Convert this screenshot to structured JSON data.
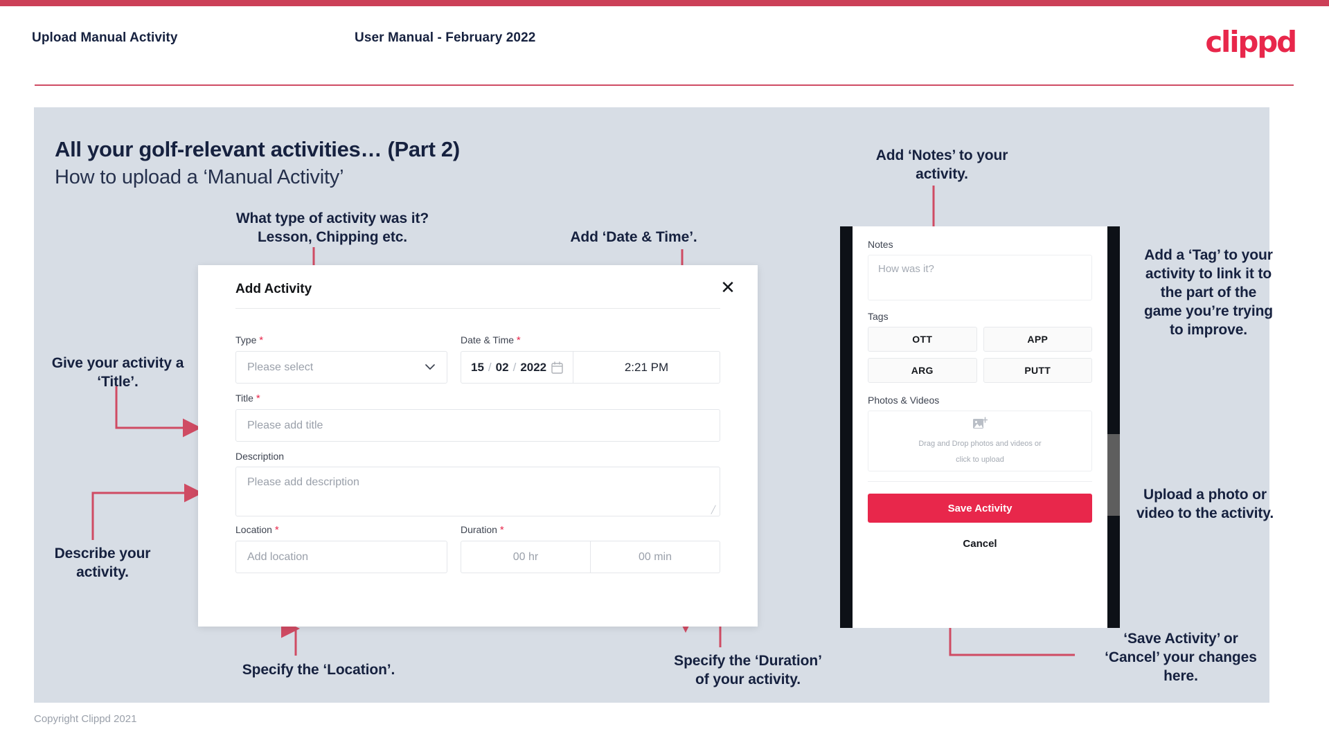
{
  "header": {
    "left_title": "Upload Manual Activity",
    "center_title": "User Manual - February 2022",
    "logo": "clippd"
  },
  "slide": {
    "title": "All your golf-relevant activities… (Part 2)",
    "subtitle": "How to upload a ‘Manual Activity’"
  },
  "annotations": {
    "type": "What type of activity was it?\nLesson, Chipping etc.",
    "datetime": "Add ‘Date & Time’.",
    "title_field": "Give your activity a\n‘Title’.",
    "description": "Describe your\nactivity.",
    "location": "Specify the ‘Location’.",
    "duration": "Specify the ‘Duration’\nof your activity.",
    "notes": "Add ‘Notes’ to your\nactivity.",
    "tags": "Add a ‘Tag’ to your\nactivity to link it to\nthe part of the\ngame you’re trying\nto improve.",
    "photos": "Upload a photo or\nvideo to the activity.",
    "save_cancel": "‘Save Activity’ or\n‘Cancel’ your changes\nhere."
  },
  "dialog": {
    "title": "Add Activity",
    "close_icon": "close-icon",
    "fields": {
      "type": {
        "label": "Type",
        "required": "*",
        "placeholder": "Please select",
        "chevron": "chevron-down-icon"
      },
      "datetime": {
        "label": "Date & Time",
        "required": "*",
        "day": "15",
        "sep1": "/",
        "month": "02",
        "sep2": "/",
        "year": "2022",
        "calendar_icon": "calendar-icon",
        "time": "2:21 PM"
      },
      "title": {
        "label": "Title",
        "required": "*",
        "placeholder": "Please add title"
      },
      "description": {
        "label": "Description",
        "required": "",
        "placeholder": "Please add description"
      },
      "location": {
        "label": "Location",
        "required": "*",
        "placeholder": "Add location"
      },
      "duration": {
        "label": "Duration",
        "required": "*",
        "hours": "00 hr",
        "minutes": "00 min"
      }
    }
  },
  "phone": {
    "notes": {
      "label": "Notes",
      "placeholder": "How was it?"
    },
    "tags": {
      "label": "Tags",
      "items": [
        "OTT",
        "APP",
        "ARG",
        "PUTT"
      ]
    },
    "photos": {
      "label": "Photos & Videos",
      "icon": "add-image-icon",
      "dropzone_line1": "Drag and Drop photos and videos or",
      "dropzone_line2": "click to upload"
    },
    "save_label": "Save Activity",
    "cancel_label": "Cancel"
  },
  "footer": {
    "copyright": "Copyright Clippd 2021"
  },
  "colors": {
    "brand_pink": "#e8274b",
    "rule_crimson": "#cc4058",
    "panel_gray": "#d7dde5",
    "ink": "#16213f",
    "connector": "#cf4b63"
  }
}
